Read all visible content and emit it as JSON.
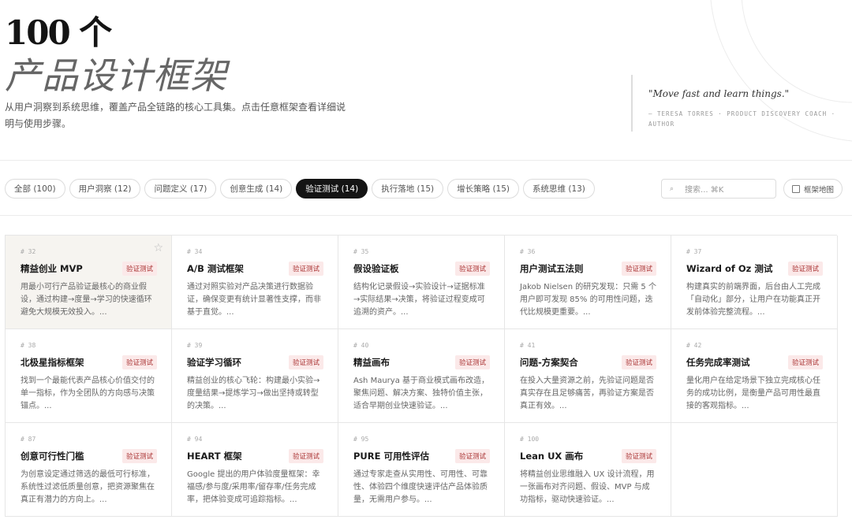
{
  "header": {
    "title_line1": "100 个",
    "title_line2": "产品设计框架",
    "subtitle": "从用户洞察到系统思维，覆盖产品全链路的核心工具集。点击任意框架查看详细说明与使用步骤。"
  },
  "quote": {
    "text": "\"Move fast and learn things.\"",
    "author": "— TERESA TORRES · PRODUCT DISCOVERY COACH · AUTHOR"
  },
  "filters": [
    {
      "label": "全部 (100)"
    },
    {
      "label": "用户洞察 (12)"
    },
    {
      "label": "问题定义 (17)"
    },
    {
      "label": "创意生成 (14)"
    },
    {
      "label": "验证测试 (14)",
      "active": true
    },
    {
      "label": "执行落地 (15)"
    },
    {
      "label": "增长策略 (15)"
    },
    {
      "label": "系统思维 (13)"
    }
  ],
  "search": {
    "placeholder": "搜索... ⌘K",
    "icon": "search-icon"
  },
  "map_button": {
    "label": "框架地图",
    "icon": "map-icon"
  },
  "cards": [
    {
      "num": "# 32",
      "title": "精益创业 MVP",
      "tag": "验证测试",
      "desc": "用最小可行产品验证最核心的商业假设，通过构建→度量→学习的快速循环避免大规模无效投入。..."
    },
    {
      "num": "# 34",
      "title": "A/B 测试框架",
      "tag": "验证测试",
      "desc": "通过对照实验对产品决策进行数据验证，确保变更有统计显著性支撑，而非基于直觉。..."
    },
    {
      "num": "# 35",
      "title": "假设验证板",
      "tag": "验证测试",
      "desc": "结构化记录假设→实验设计→证据标准→实际结果→决策，将验证过程变成可追溯的资产。..."
    },
    {
      "num": "# 36",
      "title": "用户测试五法则",
      "tag": "验证测试",
      "desc": "Jakob Nielsen 的研究发现：只需 5 个用户即可发现 85% 的可用性问题，迭代比规模更重要。..."
    },
    {
      "num": "# 37",
      "title": "Wizard of Oz 测试",
      "tag": "验证测试",
      "desc": "构建真实的前端界面，后台由人工完成「自动化」部分，让用户在功能真正开发前体验完整流程。..."
    },
    {
      "num": "# 38",
      "title": "北极星指标框架",
      "tag": "验证测试",
      "desc": "找到一个最能代表产品核心价值交付的单一指标，作为全团队的方向感与决策锚点。..."
    },
    {
      "num": "# 39",
      "title": "验证学习循环",
      "tag": "验证测试",
      "desc": "精益创业的核心飞轮：构建最小实验→度量结果→提炼学习→做出坚持或转型的决策。..."
    },
    {
      "num": "# 40",
      "title": "精益画布",
      "tag": "验证测试",
      "desc": "Ash Maurya 基于商业模式画布改造，聚焦问题、解决方案、独特价值主张，适合早期创业快速验证。..."
    },
    {
      "num": "# 41",
      "title": "问题-方案契合",
      "tag": "验证测试",
      "desc": "在投入大量资源之前，先验证问题是否真实存在且足够痛苦，再验证方案是否真正有效。..."
    },
    {
      "num": "# 42",
      "title": "任务完成率测试",
      "tag": "验证测试",
      "desc": "量化用户在给定场景下独立完成核心任务的成功比例，是衡量产品可用性最直接的客观指标。..."
    },
    {
      "num": "# 87",
      "title": "创意可行性门槛",
      "tag": "验证测试",
      "desc": "为创意设定通过筛选的最低可行标准，系统性过滤低质量创意，把资源聚焦在真正有潜力的方向上。..."
    },
    {
      "num": "# 94",
      "title": "HEART 框架",
      "tag": "验证测试",
      "desc": "Google 提出的用户体验度量框架：幸福感/参与度/采用率/留存率/任务完成率，把体验变成可追踪指标。..."
    },
    {
      "num": "# 95",
      "title": "PURE 可用性评估",
      "tag": "验证测试",
      "desc": "通过专家走查从实用性、可用性、可靠性、体验四个维度快速评估产品体验质量，无需用户参与。..."
    },
    {
      "num": "# 100",
      "title": "Lean UX 画布",
      "tag": "验证测试",
      "desc": "将精益创业思维融入 UX 设计流程，用一张画布对齐问题、假设、MVP 与成功指标，驱动快速验证。..."
    }
  ]
}
